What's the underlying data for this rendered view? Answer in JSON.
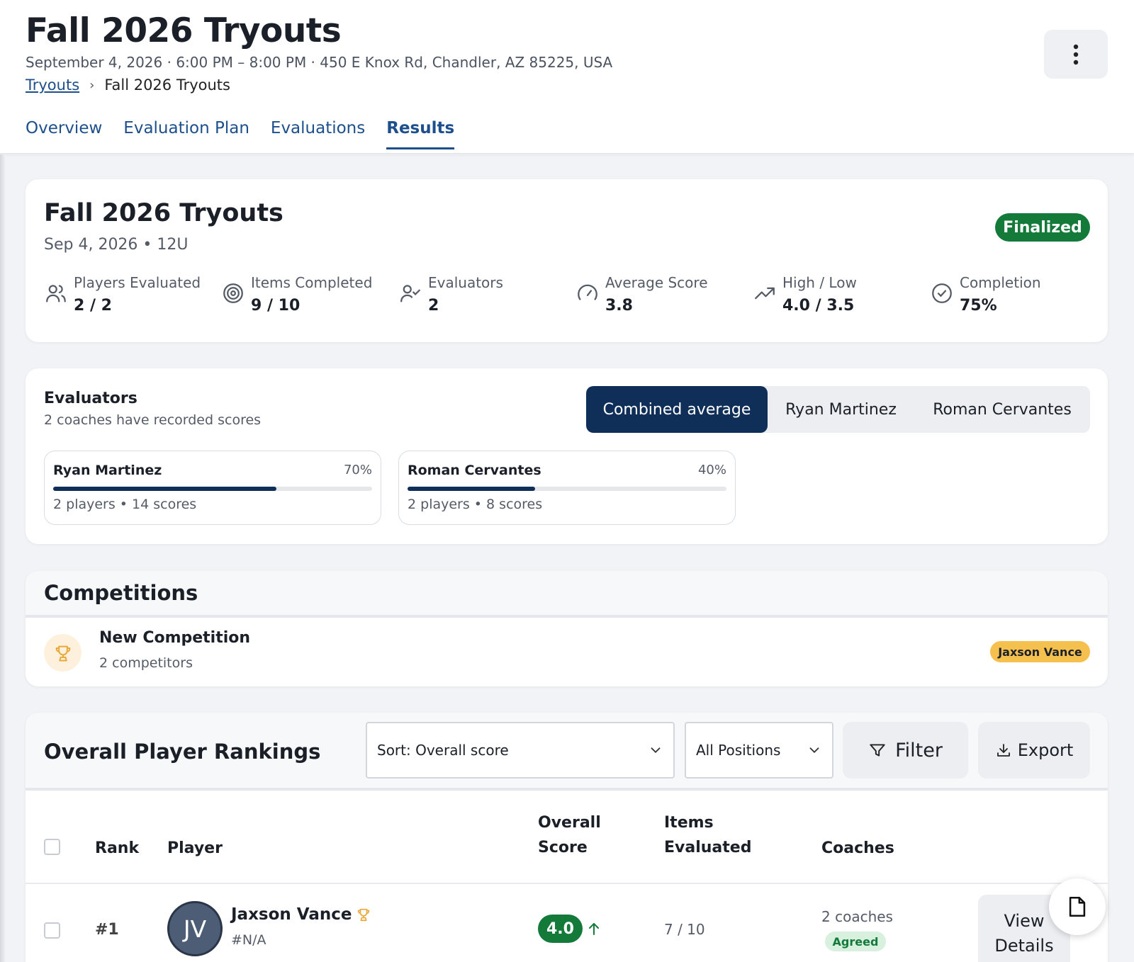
{
  "header": {
    "title": "Fall 2026 Tryouts",
    "subline": "September 4, 2026 · 6:00 PM – 8:00 PM · 450 E Knox Rd, Chandler, AZ 85225, USA",
    "breadcrumb": {
      "parent": "Tryouts",
      "separator": "›",
      "current": "Fall 2026 Tryouts"
    },
    "more_icon": "more-vertical-icon"
  },
  "tabs": [
    {
      "label": "Overview",
      "active": false
    },
    {
      "label": "Evaluation Plan",
      "active": false
    },
    {
      "label": "Evaluations",
      "active": false
    },
    {
      "label": "Results",
      "active": true
    }
  ],
  "summary": {
    "title": "Fall 2026 Tryouts",
    "subtitle": "Sep 4, 2026  • 12U",
    "status": "Finalized",
    "stats": [
      {
        "icon": "users-icon",
        "label": "Players Evaluated",
        "value": "2 / 2"
      },
      {
        "icon": "target-icon",
        "label": "Items Completed",
        "value": "9 / 10"
      },
      {
        "icon": "user-check-icon",
        "label": "Evaluators",
        "value": "2"
      },
      {
        "icon": "gauge-icon",
        "label": "Average Score",
        "value": "3.8"
      },
      {
        "icon": "trending-up-icon",
        "label": "High / Low",
        "value": "4.0 / 3.5"
      },
      {
        "icon": "check-circle-icon",
        "label": "Completion",
        "value": "75%"
      }
    ]
  },
  "evaluators": {
    "title": "Evaluators",
    "subtitle": "2 coaches have recorded scores",
    "view_options": [
      "Combined average",
      "Ryan Martinez",
      "Roman Cervantes"
    ],
    "selected_view": "Combined average",
    "list": [
      {
        "name": "Ryan Martinez",
        "percent_label": "70%",
        "percent": 70,
        "meta": "2 players • 14 scores"
      },
      {
        "name": "Roman Cervantes",
        "percent_label": "40%",
        "percent": 40,
        "meta": "2 players • 8 scores"
      }
    ]
  },
  "competitions": {
    "title": "Competitions",
    "items": [
      {
        "icon": "trophy-icon",
        "name": "New Competition",
        "meta": "2 competitors",
        "winner": "Jaxson Vance"
      }
    ]
  },
  "rankings": {
    "title": "Overall Player Rankings",
    "sort_value": "Sort: Overall score",
    "position_value": "All Positions",
    "filter_label": "Filter",
    "export_label": "Export",
    "columns": {
      "rank": "Rank",
      "player": "Player",
      "score_line1": "Overall",
      "score_line2": "Score",
      "items_line1": "Items",
      "items_line2": "Evaluated",
      "coaches": "Coaches"
    },
    "rows": [
      {
        "rank": "#1",
        "initials": "JV",
        "name": "Jaxson Vance",
        "number": "#N/A",
        "score": "4.0",
        "trend": "up-arrow-icon",
        "items": "7 / 10",
        "coaches": "2 coaches",
        "agreement": "Agreed",
        "action_line1": "View",
        "action_line2": "Details"
      }
    ]
  },
  "colors": {
    "primary": "#1d4f8c",
    "navy": "#0f2f59",
    "success": "#137a3a",
    "gold": "#f6c04f"
  }
}
